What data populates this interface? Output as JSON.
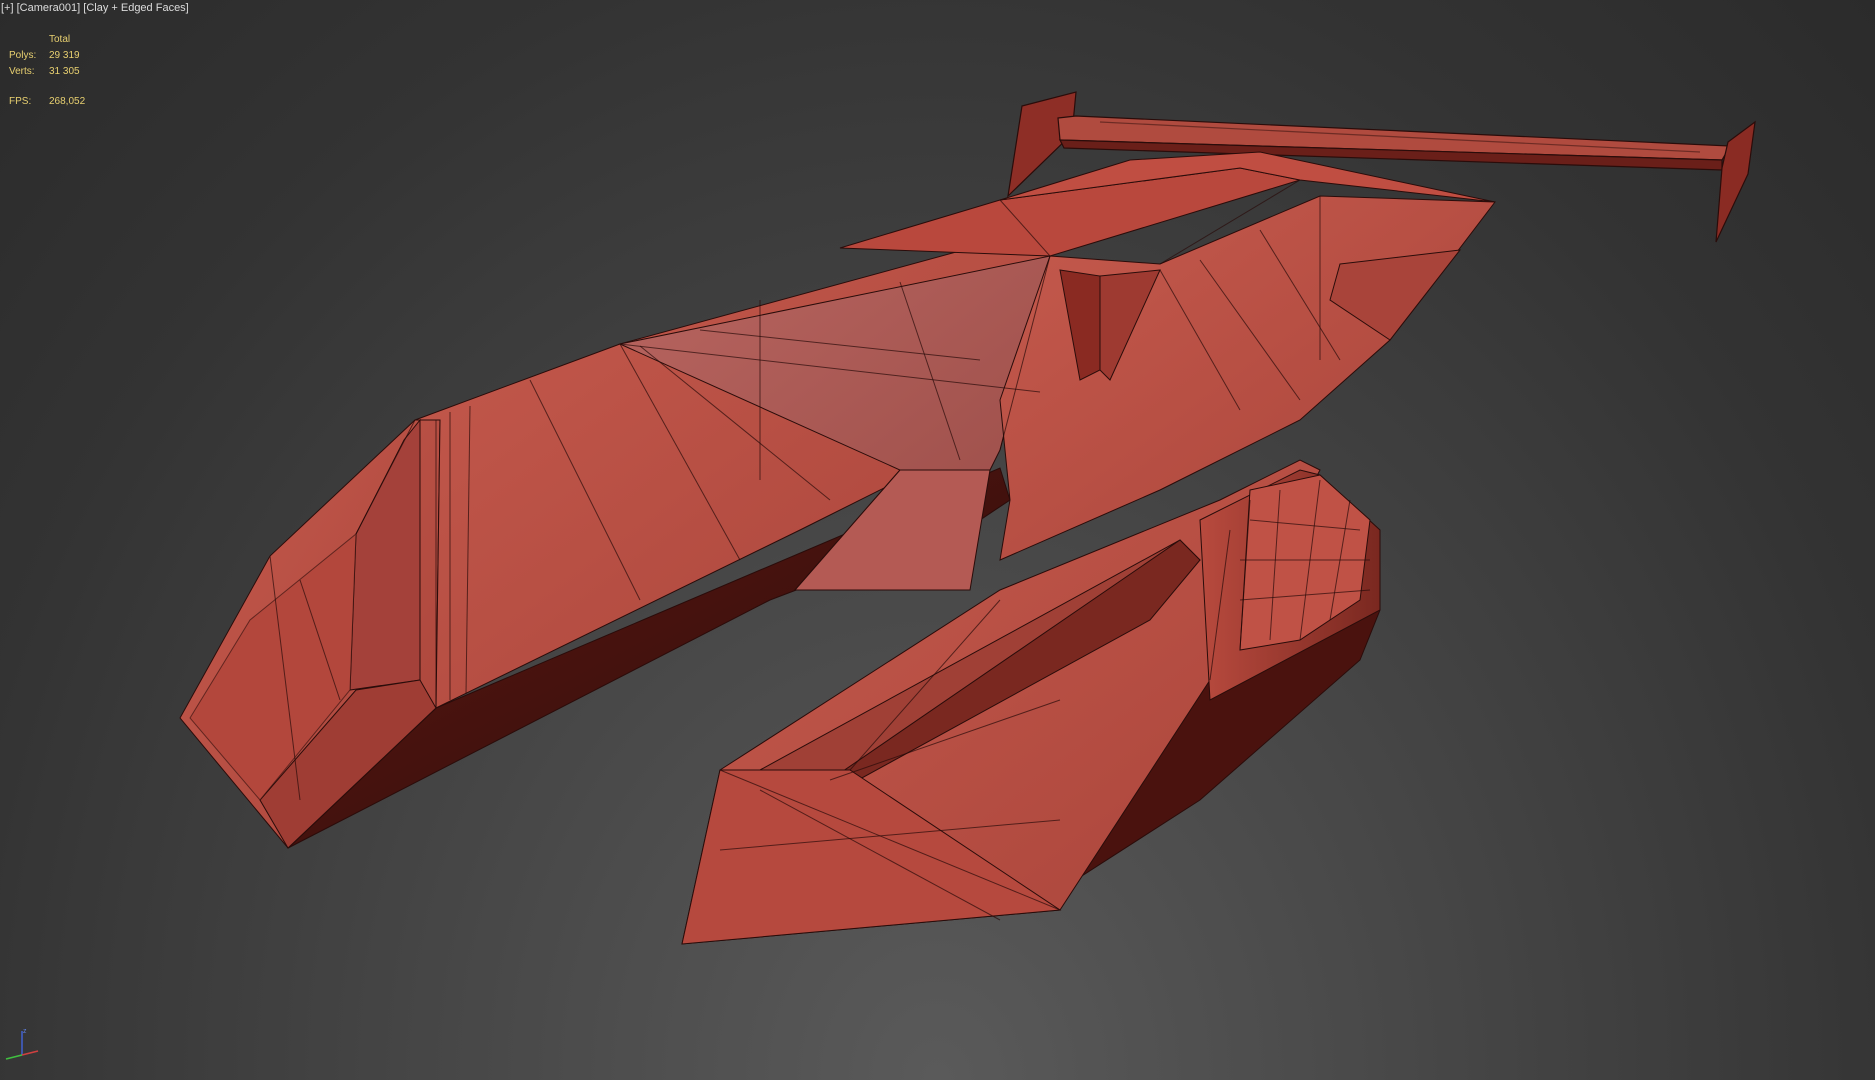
{
  "viewport": {
    "label_prefix": "[+]",
    "camera": "[Camera001]",
    "shading": "[Clay + Edged Faces]"
  },
  "stats": {
    "header": "Total",
    "polys_label": "Polys:",
    "polys_value": "29 319",
    "verts_label": "Verts:",
    "verts_value": "31 305",
    "fps_label": "FPS:",
    "fps_value": "268,052"
  },
  "gizmo": {
    "z_label": "z",
    "axis_colors": {
      "x": "#d04040",
      "y": "#40c040",
      "z": "#4060d0"
    }
  },
  "colors": {
    "clay": "#b84a3e",
    "clay_light": "#c8574a",
    "clay_dark": "#5a1a16",
    "edge": "#2a0c0a",
    "stats_text": "#e8d070"
  }
}
